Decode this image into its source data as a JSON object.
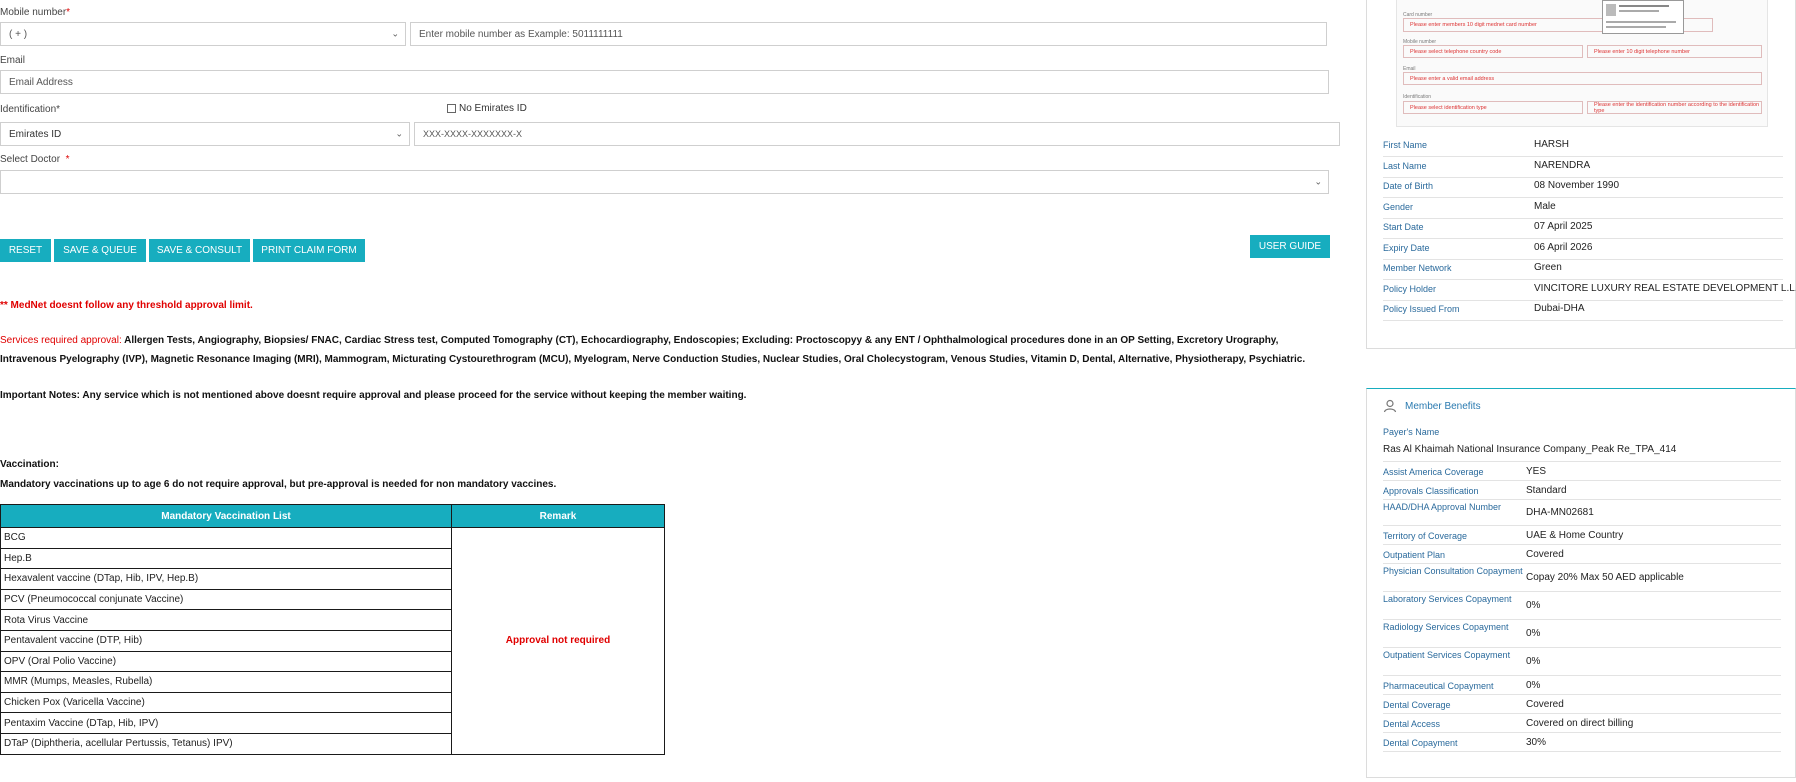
{
  "form": {
    "mobile_label": "Mobile number",
    "required_star": "*",
    "country_code": "( + )",
    "mobile_placeholder": "Enter mobile number as Example: 5011111111",
    "email_label": "Email",
    "email_placeholder": "Email Address",
    "identification_label": "Identification*",
    "no_emirates_label": "No Emirates ID",
    "id_type_value": "Emirates ID",
    "id_number_placeholder": "XXX-XXXX-XXXXXXX-X",
    "doctor_label": "Select Doctor",
    "doctor_star": "*",
    "doctor_value": ""
  },
  "buttons": {
    "reset": "RESET",
    "save_queue": "SAVE & QUEUE",
    "save_consult": "SAVE & CONSULT",
    "print_claim": "PRINT CLAIM FORM",
    "user_guide": "USER GUIDE"
  },
  "notices": {
    "threshold": "** MedNet doesnt follow any threshold approval limit.",
    "services_label": "Services required approval:",
    "services_text": " Allergen Tests, Angiography, Biopsies/ FNAC, Cardiac Stress test, Computed Tomography (CT), Echocardiography, Endoscopies; Excluding: Proctoscopyy & any ENT / Ophthalmological procedures done in an OP Setting, Excretory Urography, Intravenous Pyelography (IVP), Magnetic Resonance Imaging (MRI), Mammogram, Micturating Cystourethrogram (MCU), Myelogram, Nerve Conduction Studies, Nuclear Studies, Oral Cholecystogram, Venous Studies, Vitamin D, Dental, Alternative, Physiotherapy, Psychiatric.",
    "important": "Important Notes: Any service which is not mentioned above doesnt require approval and please proceed for the service without keeping the member waiting.",
    "vaccination_title": "Vaccination:",
    "vaccination_text": "Mandatory vaccinations up to age 6 do not require approval, but pre-approval is needed for non mandatory vaccines."
  },
  "vaccination_table": {
    "headers": [
      "Mandatory Vaccination List",
      "Remark"
    ],
    "rows": [
      "BCG",
      "Hep.B",
      "Hexavalent vaccine (DTap, Hib, IPV, Hep.B)",
      "PCV (Pneumococcal conjunate Vaccine)",
      "Rota Virus Vaccine",
      "Pentavalent vaccine (DTP, Hib)",
      "OPV (Oral Polio Vaccine)",
      "MMR (Mumps, Measles, Rubella)",
      "Chicken Pox (Varicella Vaccine)",
      "Pentaxim Vaccine (DTap, Hib, IPV)",
      "DTaP (Diphtheria, acellular Pertussis, Tetanus) IPV)"
    ],
    "remark": "Approval not required"
  },
  "reference_image": {
    "card_number_label": "Card number",
    "card_number_hint": "Please enter members 10 digit mednet card number",
    "mobile_label": "Mobile number",
    "mobile_code_hint": "Please select telephone country code",
    "mobile_hint": "Please enter 10 digit telephone number",
    "email_label": "Email",
    "email_hint": "Please enter a valid email address",
    "identification_label": "Identification",
    "id_type_hint": "Please select identification type",
    "id_number_hint": "Please enter the identification number according to the identification type"
  },
  "member_info": [
    {
      "key": "First Name",
      "value": "HARSH"
    },
    {
      "key": "Last Name",
      "value": "NARENDRA"
    },
    {
      "key": "Date of Birth",
      "value": "08 November 1990"
    },
    {
      "key": "Gender",
      "value": "Male"
    },
    {
      "key": "Start Date",
      "value": "07 April 2025"
    },
    {
      "key": "Expiry Date",
      "value": "06 April 2026"
    },
    {
      "key": "Member Network",
      "value": "Green"
    },
    {
      "key": "Policy Holder",
      "value": "VINCITORE LUXURY REAL ESTATE DEVELOPMENT L.L.C"
    },
    {
      "key": "Policy Issued From",
      "value": "Dubai-DHA"
    }
  ],
  "benefits": {
    "title": "Member Benefits",
    "payer_label": "Payer's Name",
    "payer_value": "Ras Al Khaimah National Insurance Company_Peak Re_TPA_414",
    "rows": [
      {
        "key": "Assist America Coverage",
        "value": "YES"
      },
      {
        "key": "Approvals Classification",
        "value": "Standard"
      },
      {
        "key": "HAAD/DHA Approval Number",
        "value": "DHA-MN02681"
      },
      {
        "key": "Territory of Coverage",
        "value": "UAE & Home Country"
      },
      {
        "key": "Outpatient Plan",
        "value": "Covered"
      },
      {
        "key": "Physician Consultation Copayment",
        "value": "Copay 20% Max 50 AED applicable"
      },
      {
        "key": "Laboratory Services Copayment",
        "value": "0%"
      },
      {
        "key": "Radiology Services Copayment",
        "value": "0%"
      },
      {
        "key": "Outpatient Services Copayment",
        "value": "0%"
      },
      {
        "key": "Pharmaceutical Copayment",
        "value": "0%"
      },
      {
        "key": "Dental Coverage",
        "value": "Covered"
      },
      {
        "key": "Dental Access",
        "value": "Covered on direct billing"
      },
      {
        "key": "Dental Copayment",
        "value": "30%"
      }
    ]
  }
}
